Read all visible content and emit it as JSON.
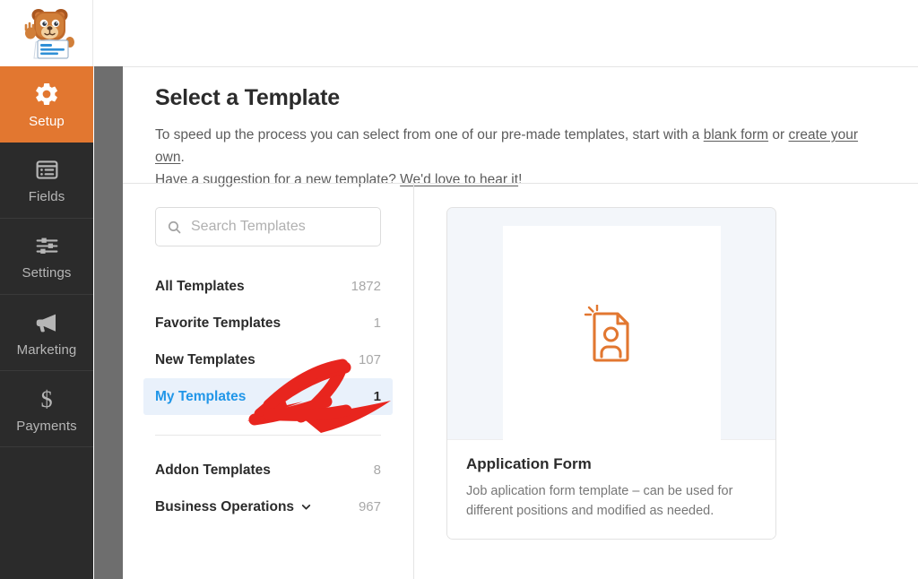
{
  "brand": {
    "logo_icon": "wpforms-mascot-icon",
    "accent_color": "#e27730",
    "sidebar_color": "#2b2b2b",
    "highlight_color": "#e9f1fb",
    "link_color": "#2196e8"
  },
  "sidebar": {
    "items": [
      {
        "label": "Setup",
        "icon": "gear-icon",
        "active": true
      },
      {
        "label": "Fields",
        "icon": "form-list-icon",
        "active": false
      },
      {
        "label": "Settings",
        "icon": "sliders-icon",
        "active": false
      },
      {
        "label": "Marketing",
        "icon": "megaphone-icon",
        "active": false
      },
      {
        "label": "Payments",
        "icon": "dollar-icon",
        "active": false
      }
    ]
  },
  "page": {
    "title": "Select a Template",
    "desc_line1_a": "To speed up the process you can select from one of our pre-made templates, start with a ",
    "desc_link_blank": "blank form",
    "desc_line1_b": " or ",
    "desc_link_create": "create your own",
    "desc_line1_c": ".",
    "desc_line2_a": "Have a suggestion for a new template? ",
    "desc_link_suggest": "We'd love to hear it",
    "desc_line2_b": "!"
  },
  "search": {
    "placeholder": "Search Templates",
    "value": "",
    "icon": "search-icon"
  },
  "categories": {
    "primary": [
      {
        "label": "All Templates",
        "count": "1872",
        "selected": false
      },
      {
        "label": "Favorite Templates",
        "count": "1",
        "selected": false
      },
      {
        "label": "New Templates",
        "count": "107",
        "selected": false
      },
      {
        "label": "My Templates",
        "count": "1",
        "selected": true
      }
    ],
    "secondary": [
      {
        "label": "Addon Templates",
        "count": "8",
        "expandable": false
      },
      {
        "label": "Business Operations",
        "count": "967",
        "expandable": true
      }
    ],
    "chevron_icon": "chevron-down-icon"
  },
  "templates": [
    {
      "title": "Application Form",
      "description": "Job aplication form template – can be used for different positions and modified as needed.",
      "preview_icon": "document-person-icon"
    }
  ],
  "annotation": {
    "type": "arrow",
    "color": "#e8251e",
    "points_at": "My Templates"
  }
}
